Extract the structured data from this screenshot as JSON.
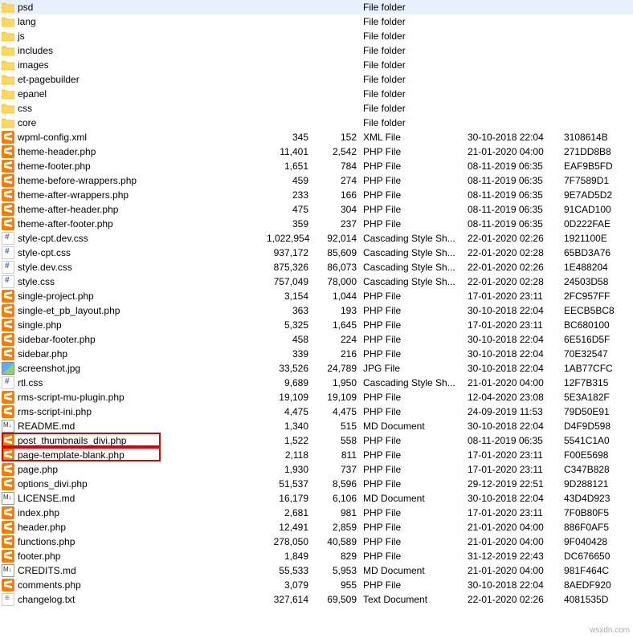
{
  "rows": [
    {
      "icon": "folder",
      "name": "psd",
      "size": "",
      "packed": "",
      "type": "File folder",
      "date": "",
      "attr": ""
    },
    {
      "icon": "folder",
      "name": "lang",
      "size": "",
      "packed": "",
      "type": "File folder",
      "date": "",
      "attr": ""
    },
    {
      "icon": "folder",
      "name": "js",
      "size": "",
      "packed": "",
      "type": "File folder",
      "date": "",
      "attr": ""
    },
    {
      "icon": "folder",
      "name": "includes",
      "size": "",
      "packed": "",
      "type": "File folder",
      "date": "",
      "attr": ""
    },
    {
      "icon": "folder",
      "name": "images",
      "size": "",
      "packed": "",
      "type": "File folder",
      "date": "",
      "attr": ""
    },
    {
      "icon": "folder",
      "name": "et-pagebuilder",
      "size": "",
      "packed": "",
      "type": "File folder",
      "date": "",
      "attr": ""
    },
    {
      "icon": "folder",
      "name": "epanel",
      "size": "",
      "packed": "",
      "type": "File folder",
      "date": "",
      "attr": ""
    },
    {
      "icon": "folder",
      "name": "css",
      "size": "",
      "packed": "",
      "type": "File folder",
      "date": "",
      "attr": ""
    },
    {
      "icon": "folder",
      "name": "core",
      "size": "",
      "packed": "",
      "type": "File folder",
      "date": "",
      "attr": ""
    },
    {
      "icon": "sublime",
      "name": "wpml-config.xml",
      "size": "345",
      "packed": "152",
      "type": "XML File",
      "date": "30-10-2018 22:04",
      "attr": "3108614B"
    },
    {
      "icon": "sublime",
      "name": "theme-header.php",
      "size": "11,401",
      "packed": "2,542",
      "type": "PHP File",
      "date": "21-01-2020 04:00",
      "attr": "271DD8B8"
    },
    {
      "icon": "sublime",
      "name": "theme-footer.php",
      "size": "1,651",
      "packed": "784",
      "type": "PHP File",
      "date": "08-11-2019 06:35",
      "attr": "EAF9B5FD"
    },
    {
      "icon": "sublime",
      "name": "theme-before-wrappers.php",
      "size": "459",
      "packed": "274",
      "type": "PHP File",
      "date": "08-11-2019 06:35",
      "attr": "7F7589D1"
    },
    {
      "icon": "sublime",
      "name": "theme-after-wrappers.php",
      "size": "233",
      "packed": "166",
      "type": "PHP File",
      "date": "08-11-2019 06:35",
      "attr": "9E7AD5D2"
    },
    {
      "icon": "sublime",
      "name": "theme-after-header.php",
      "size": "475",
      "packed": "304",
      "type": "PHP File",
      "date": "08-11-2019 06:35",
      "attr": "91CAD100"
    },
    {
      "icon": "sublime",
      "name": "theme-after-footer.php",
      "size": "359",
      "packed": "237",
      "type": "PHP File",
      "date": "08-11-2019 06:35",
      "attr": "0D222FAE"
    },
    {
      "icon": "css",
      "name": "style-cpt.dev.css",
      "size": "1,022,954",
      "packed": "92,014",
      "type": "Cascading Style Sh...",
      "date": "22-01-2020 02:26",
      "attr": "1921100E"
    },
    {
      "icon": "css",
      "name": "style-cpt.css",
      "size": "937,172",
      "packed": "85,609",
      "type": "Cascading Style Sh...",
      "date": "22-01-2020 02:28",
      "attr": "65BD3A76"
    },
    {
      "icon": "css",
      "name": "style.dev.css",
      "size": "875,326",
      "packed": "86,073",
      "type": "Cascading Style Sh...",
      "date": "22-01-2020 02:26",
      "attr": "1E488204"
    },
    {
      "icon": "css",
      "name": "style.css",
      "size": "757,049",
      "packed": "78,000",
      "type": "Cascading Style Sh...",
      "date": "22-01-2020 02:28",
      "attr": "24503D58"
    },
    {
      "icon": "sublime",
      "name": "single-project.php",
      "size": "3,154",
      "packed": "1,044",
      "type": "PHP File",
      "date": "17-01-2020 23:11",
      "attr": "2FC957FF"
    },
    {
      "icon": "sublime",
      "name": "single-et_pb_layout.php",
      "size": "363",
      "packed": "193",
      "type": "PHP File",
      "date": "30-10-2018 22:04",
      "attr": "EECB5BC8"
    },
    {
      "icon": "sublime",
      "name": "single.php",
      "size": "5,325",
      "packed": "1,645",
      "type": "PHP File",
      "date": "17-01-2020 23:11",
      "attr": "BC680100"
    },
    {
      "icon": "sublime",
      "name": "sidebar-footer.php",
      "size": "458",
      "packed": "224",
      "type": "PHP File",
      "date": "30-10-2018 22:04",
      "attr": "6E516D5F"
    },
    {
      "icon": "sublime",
      "name": "sidebar.php",
      "size": "339",
      "packed": "216",
      "type": "PHP File",
      "date": "30-10-2018 22:04",
      "attr": "70E32547"
    },
    {
      "icon": "jpg",
      "name": "screenshot.jpg",
      "size": "33,526",
      "packed": "24,789",
      "type": "JPG File",
      "date": "30-10-2018 22:04",
      "attr": "1AB77CFC"
    },
    {
      "icon": "css",
      "name": "rtl.css",
      "size": "9,689",
      "packed": "1,950",
      "type": "Cascading Style Sh...",
      "date": "21-01-2020 04:00",
      "attr": "12F7B315"
    },
    {
      "icon": "sublime",
      "name": "rms-script-mu-plugin.php",
      "size": "19,109",
      "packed": "19,109",
      "type": "PHP File",
      "date": "12-04-2020 23:08",
      "attr": "5E3A182F"
    },
    {
      "icon": "sublime",
      "name": "rms-script-ini.php",
      "size": "4,475",
      "packed": "4,475",
      "type": "PHP File",
      "date": "24-09-2019 11:53",
      "attr": "79D50E91"
    },
    {
      "icon": "md",
      "name": "README.md",
      "size": "1,340",
      "packed": "515",
      "type": "MD Document",
      "date": "30-10-2018 22:04",
      "attr": "D4F9D598"
    },
    {
      "icon": "sublime",
      "name": "post_thumbnails_divi.php",
      "size": "1,522",
      "packed": "558",
      "type": "PHP File",
      "date": "08-11-2019 06:35",
      "attr": "5541C1A0"
    },
    {
      "icon": "sublime",
      "name": "page-template-blank.php",
      "size": "2,118",
      "packed": "811",
      "type": "PHP File",
      "date": "17-01-2020 23:11",
      "attr": "F00E5698"
    },
    {
      "icon": "sublime",
      "name": "page.php",
      "size": "1,930",
      "packed": "737",
      "type": "PHP File",
      "date": "17-01-2020 23:11",
      "attr": "C347B828"
    },
    {
      "icon": "sublime",
      "name": "options_divi.php",
      "size": "51,537",
      "packed": "8,596",
      "type": "PHP File",
      "date": "29-12-2019 22:51",
      "attr": "9D288121"
    },
    {
      "icon": "md",
      "name": "LICENSE.md",
      "size": "16,179",
      "packed": "6,106",
      "type": "MD Document",
      "date": "30-10-2018 22:04",
      "attr": "43D4D923"
    },
    {
      "icon": "sublime",
      "name": "index.php",
      "size": "2,681",
      "packed": "981",
      "type": "PHP File",
      "date": "17-01-2020 23:11",
      "attr": "7F0B80F5"
    },
    {
      "icon": "sublime",
      "name": "header.php",
      "size": "12,491",
      "packed": "2,859",
      "type": "PHP File",
      "date": "21-01-2020 04:00",
      "attr": "886F0AF5"
    },
    {
      "icon": "sublime",
      "name": "functions.php",
      "size": "278,050",
      "packed": "40,589",
      "type": "PHP File",
      "date": "21-01-2020 04:00",
      "attr": "9F040428"
    },
    {
      "icon": "sublime",
      "name": "footer.php",
      "size": "1,849",
      "packed": "829",
      "type": "PHP File",
      "date": "31-12-2019 22:43",
      "attr": "DC676650"
    },
    {
      "icon": "md",
      "name": "CREDITS.md",
      "size": "55,533",
      "packed": "5,953",
      "type": "MD Document",
      "date": "21-01-2020 04:00",
      "attr": "981F464C"
    },
    {
      "icon": "sublime",
      "name": "comments.php",
      "size": "3,079",
      "packed": "955",
      "type": "PHP File",
      "date": "30-10-2018 22:04",
      "attr": "8AEDF920"
    },
    {
      "icon": "txt",
      "name": "changelog.txt",
      "size": "327,614",
      "packed": "69,509",
      "type": "Text Document",
      "date": "22-01-2020 02:26",
      "attr": "4081535D"
    }
  ],
  "watermark": "wsxdn.com"
}
